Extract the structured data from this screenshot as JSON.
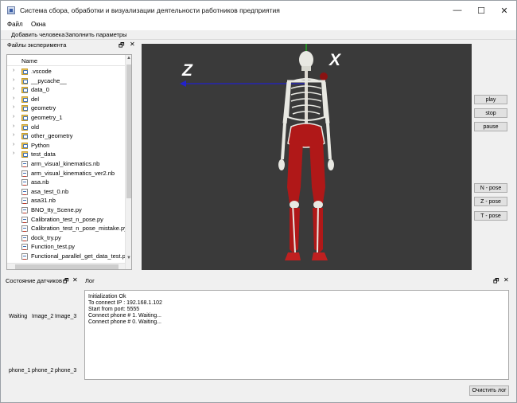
{
  "window": {
    "title": "Система сбора, обработки и визуализации деятельности работников предприятия",
    "minimize_glyph": "—",
    "maximize_glyph": "☐",
    "close_glyph": "✕"
  },
  "menu": {
    "file": "Файл",
    "windows": "Окна"
  },
  "toolbar": {
    "add_person": "Добавить человека",
    "fill_params": "Заполнить параметры"
  },
  "files_dock": {
    "title": "Файлы эксперимента",
    "float_glyph": "🗗",
    "close_glyph": "✕",
    "column_name": "Name",
    "items": [
      {
        "name": ".vscode",
        "type": "folder"
      },
      {
        "name": "__pycache__",
        "type": "folder"
      },
      {
        "name": "data_0",
        "type": "folder"
      },
      {
        "name": "del",
        "type": "folder"
      },
      {
        "name": "geometry",
        "type": "folder"
      },
      {
        "name": "geometry_1",
        "type": "folder"
      },
      {
        "name": "old",
        "type": "folder"
      },
      {
        "name": "other_geometry",
        "type": "folder"
      },
      {
        "name": "Python",
        "type": "folder"
      },
      {
        "name": "test_data",
        "type": "folder"
      },
      {
        "name": "arm_visual_kinematics.nb",
        "type": "file"
      },
      {
        "name": "arm_visual_kinematics_ver2.nb",
        "type": "file"
      },
      {
        "name": "asa.nb",
        "type": "file"
      },
      {
        "name": "asa_test_0.nb",
        "type": "file"
      },
      {
        "name": "asa31.nb",
        "type": "file"
      },
      {
        "name": "BNO_tty_Scene.py",
        "type": "file"
      },
      {
        "name": "Calibration_test_n_pose.py",
        "type": "file"
      },
      {
        "name": "Calibration_test_n_pose_mistake.py",
        "type": "file"
      },
      {
        "name": "dock_try.py",
        "type": "file"
      },
      {
        "name": "Function_test.py",
        "type": "file"
      },
      {
        "name": "Functional_parallel_get_data_test.py",
        "type": "file"
      }
    ]
  },
  "viewport": {
    "axis_z": "Z",
    "axis_x": "X"
  },
  "controls": {
    "play": "play",
    "stop": "stop",
    "pause": "pause",
    "n_pose": "N - pose",
    "z_pose": "Z - pose",
    "t_pose": "T - pose"
  },
  "sensor_dock": {
    "title": "Состояние датчиков",
    "float_glyph": "🗗",
    "close_glyph": "✕",
    "top_labels": [
      "Waiting",
      "Image_2",
      "Image_3"
    ],
    "bottom_labels": [
      "phone_1",
      "phone_2",
      "phone_3"
    ]
  },
  "log_dock": {
    "title": "Лог",
    "float_glyph": "🗗",
    "close_glyph": "✕",
    "lines": [
      "Initialization Ok",
      "To connect IP : 192.168.1.102",
      "Start from port: 5555",
      "Connect phone # 1. Waiting...",
      "Connect phone # 0. Waiting..."
    ],
    "clear_button": "Очистить лог"
  },
  "colors": {
    "viewport_bg": "#3a3a3a",
    "axis_blue": "#2222cc",
    "axis_green": "#22aa22",
    "muscle_red": "#b01818",
    "bone": "#e8e8e2"
  }
}
